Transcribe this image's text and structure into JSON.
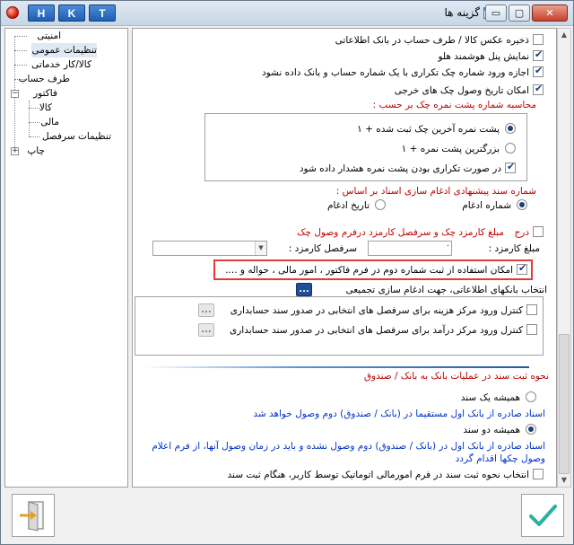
{
  "titlebar": {
    "title": "گزینه ها",
    "hk_buttons": [
      "H",
      "K",
      "T"
    ],
    "controls": {
      "minimize": "▭",
      "maximize": "▢",
      "close": "✕"
    }
  },
  "tree": {
    "items": [
      {
        "label": "امنیتی"
      },
      {
        "label": "تنظیمات عمومی",
        "selected": true
      },
      {
        "label": "کالا/کار خدماتی"
      },
      {
        "label": "طرف حساب"
      },
      {
        "label": "فاکتور",
        "expander": "−"
      },
      {
        "label": "کالا"
      },
      {
        "label": "مالی"
      },
      {
        "label": "تنظیمات سرفصل"
      },
      {
        "label": "چاپ",
        "expander": "+"
      }
    ]
  },
  "options": {
    "save_goods_image": "ذخیره عکس کالا / طرف حساب در بانک اطلاعاتی",
    "show_smart_panel": "نمایش پنل هوشمند هلو",
    "allow_duplicate_cheque": "اجازه ورود شماره چک تکراری با یک شماره حساب و بانک داده نشود",
    "cheque_receipt_date": "امکان تاریخ وصول چک های خرجی",
    "back_number_heading": "محاسبه شماره پشت نمره چک بر حسب :",
    "back_last_plus_one": "پشت نمره آخرین چک ثبت شده + ۱",
    "back_biggest_plus_one": "بزرگترین پشت نمره + ۱",
    "back_duplicate_warning": "در صورت تکراری بودن پشت نمره هشدار داده شود",
    "merge_heading": "شماره سند پیشنهادی ادغام سازی اسناد بر اساس :",
    "merge_number": "شماره ادغام",
    "merge_date": "تاریخ ادغام",
    "fee_prefix": "درج",
    "fee_cheque_and_heading": "مبلغ کارمزد چک  و سرفصل  کارمزد درفرم وصول چک",
    "fee_amount_label": "مبلغ کارمزد :",
    "fee_amount_value": "۰",
    "fee_heading_label": "سرفصل  کارمزد :",
    "bank_text_option": "امکان استفاده از ثبت شماره دوم در فرم فاکتور ، امور مالی ، حواله و ....",
    "bank_select_label": "انتخاب بانکهای اطلاعاتی، جهت ادغام سازی تجمیعی",
    "cost_center_control": "کنترل ورود مرکز هزینه برای سرفصل های انتخابی در صدور سند حسابداری",
    "revenue_center_control": "کنترل ورود مرکز درآمد برای سرفصل های انتخابی در صدور سند حسابداری",
    "ellipsis": "..."
  },
  "bank_section": {
    "header": "نحوه ثبت سند در عملیات بانک به بانک / صندوق",
    "always_one_doc": "همیشه یک سند",
    "one_doc_desc": "اسناد صادره از بانک اول مستقیما در (بانک / صندوق) دوم وصول خواهد شد",
    "always_two_docs": "همیشه دو سند",
    "two_docs_desc": "اسناد صادره از بانک اول در (بانک / صندوق) دوم وصول نشده و باید در زمان وصول آنها، از فرم اعلام وصول چکها اقدام گردد",
    "auto_select": "انتخاب نحوه ثبت سند در فرم امورمالی اتوماتیک توسط کاربر، هنگام ثبت سند"
  },
  "footer": {
    "exit_icon": "exit-door-icon",
    "confirm_icon": "checkmark-icon"
  },
  "colors": {
    "red_text": "#c00000",
    "blue_text": "#0033cc",
    "highlight": "#e23a3a",
    "accent": "#1f4f98"
  }
}
